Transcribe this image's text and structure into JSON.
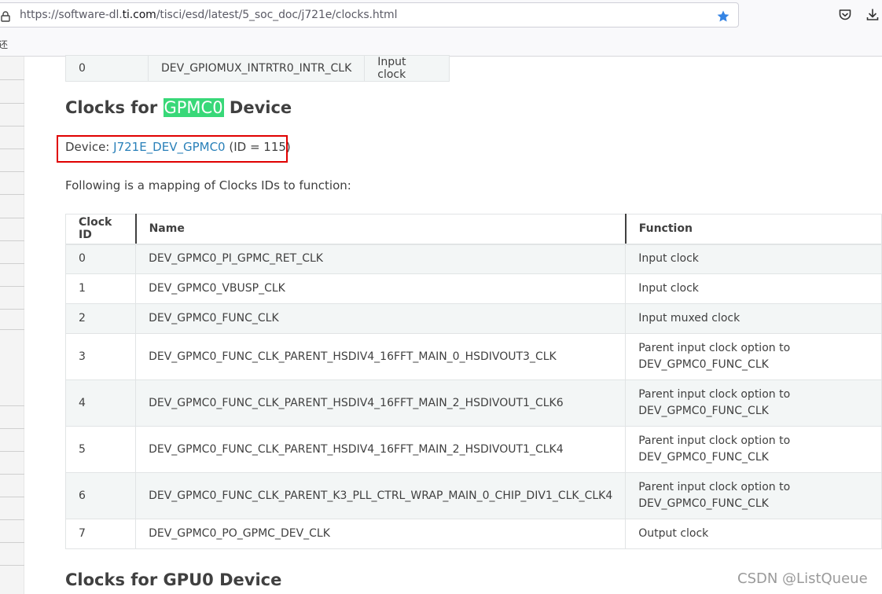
{
  "browser": {
    "url_prefix": "https://software-dl.",
    "url_domain": "ti.com",
    "url_path": "/tisci/esd/latest/5_soc_doc/j721e/clocks.html",
    "bookmarks_glyph": "还"
  },
  "prev_table": {
    "row": {
      "id": "0",
      "name": "DEV_GPIOMUX_INTRTR0_INTR_CLK",
      "function": "Input clock"
    }
  },
  "section": {
    "heading_prefix": "Clocks for",
    "heading_highlight": "GPMC0",
    "heading_suffix": "Device",
    "device_label": "Device:",
    "device_link": "J721E_DEV_GPMC0",
    "device_id": "(ID = 115)",
    "intro": "Following is a mapping of Clocks IDs to function:"
  },
  "table": {
    "headers": [
      "Clock ID",
      "Name",
      "Function"
    ],
    "rows": [
      {
        "id": "0",
        "name": "DEV_GPMC0_PI_GPMC_RET_CLK",
        "function": "Input clock"
      },
      {
        "id": "1",
        "name": "DEV_GPMC0_VBUSP_CLK",
        "function": "Input clock"
      },
      {
        "id": "2",
        "name": "DEV_GPMC0_FUNC_CLK",
        "function": "Input muxed clock"
      },
      {
        "id": "3",
        "name": "DEV_GPMC0_FUNC_CLK_PARENT_HSDIV4_16FFT_MAIN_0_HSDIVOUT3_CLK",
        "function_line1": "Parent input clock option to",
        "function_line2": "DEV_GPMC0_FUNC_CLK"
      },
      {
        "id": "4",
        "name": "DEV_GPMC0_FUNC_CLK_PARENT_HSDIV4_16FFT_MAIN_2_HSDIVOUT1_CLK6",
        "function_line1": "Parent input clock option to",
        "function_line2": "DEV_GPMC0_FUNC_CLK"
      },
      {
        "id": "5",
        "name": "DEV_GPMC0_FUNC_CLK_PARENT_HSDIV4_16FFT_MAIN_2_HSDIVOUT1_CLK4",
        "function_line1": "Parent input clock option to",
        "function_line2": "DEV_GPMC0_FUNC_CLK"
      },
      {
        "id": "6",
        "name": "DEV_GPMC0_FUNC_CLK_PARENT_K3_PLL_CTRL_WRAP_MAIN_0_CHIP_DIV1_CLK_CLK4",
        "function_line1": "Parent input clock option to",
        "function_line2": "DEV_GPMC0_FUNC_CLK"
      },
      {
        "id": "7",
        "name": "DEV_GPMC0_PO_GPMC_DEV_CLK",
        "function": "Output clock"
      }
    ]
  },
  "next_section": {
    "heading": "Clocks for GPU0 Device"
  },
  "watermark": "CSDN @ListQueue",
  "colors": {
    "highlight": "#38d878",
    "link": "#2980b9",
    "annotation_box": "#e00000"
  }
}
